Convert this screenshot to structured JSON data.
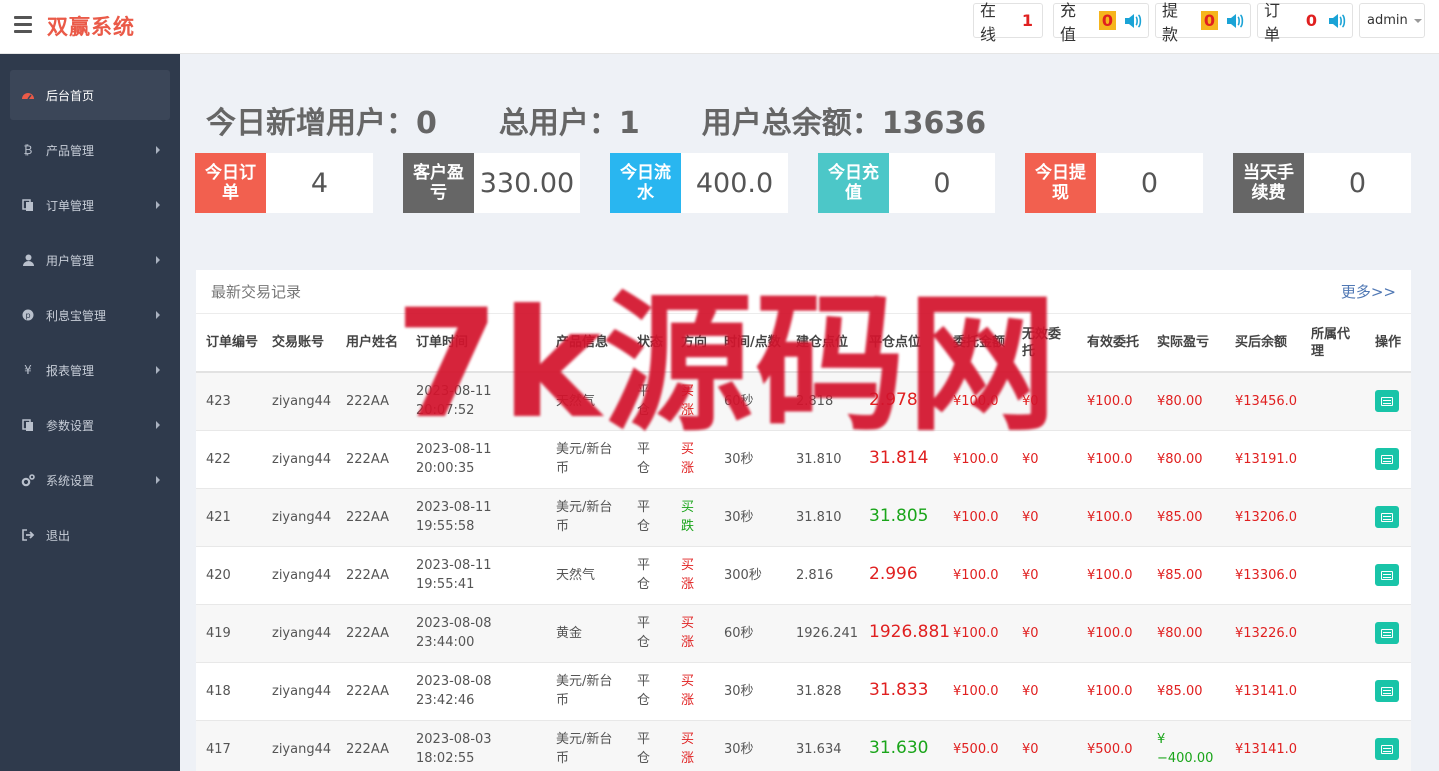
{
  "app": {
    "brand": "双赢系统"
  },
  "topbar": {
    "online_label": "在线",
    "online_count": "1",
    "recharge_label": "充值",
    "recharge_count": "0",
    "withdraw_label": "提款",
    "withdraw_count": "0",
    "order_label": "订单",
    "order_count": "0",
    "admin": "admin"
  },
  "sidebar": {
    "items": [
      {
        "label": "后台首页",
        "icon": "dashboard-icon"
      },
      {
        "label": "产品管理",
        "icon": "bitcoin-icon"
      },
      {
        "label": "订单管理",
        "icon": "copy-icon"
      },
      {
        "label": "用户管理",
        "icon": "user-icon"
      },
      {
        "label": "利息宝管理",
        "icon": "pinterest-icon"
      },
      {
        "label": "报表管理",
        "icon": "yen-icon"
      },
      {
        "label": "参数设置",
        "icon": "copy-icon"
      },
      {
        "label": "系统设置",
        "icon": "gears-icon"
      },
      {
        "label": "退出",
        "icon": "sign-out-icon"
      }
    ]
  },
  "summary": {
    "new_users": "今日新增用户：0",
    "total_users": "总用户：1",
    "total_balance": "用户总余额：13636"
  },
  "kpis": [
    {
      "label": "今日订单",
      "value": "4",
      "color": "#f2604f"
    },
    {
      "label": "客户盈亏",
      "value": "330.00",
      "color": "#666666"
    },
    {
      "label": "今日流水",
      "value": "400.0",
      "color": "#29b6f0"
    },
    {
      "label": "今日充值",
      "value": "0",
      "color": "#4cc7c8"
    },
    {
      "label": "今日提现",
      "value": "0",
      "color": "#f2604f"
    },
    {
      "label": "当天手续费",
      "value": "0",
      "color": "#666666"
    }
  ],
  "panel": {
    "title": "最新交易记录",
    "more": "更多>>",
    "headers": [
      "订单编号",
      "交易账号",
      "用户姓名",
      "订单时间",
      "产品信息",
      "状态",
      "方向",
      "时间/点数",
      "建仓点位",
      "平仓点位",
      "委托金额",
      "无效委托",
      "有效委托",
      "实际盈亏",
      "买后余额",
      "所属代理",
      "操作"
    ],
    "rows": [
      {
        "id": "423",
        "account": "ziyang44",
        "name": "222AA",
        "time": "2023-08-11 20:07:52",
        "product": "天然气",
        "status": "平仓",
        "direction": "买涨",
        "dir_color": "red",
        "period": "60秒",
        "open": "2.818",
        "close": "2.978",
        "close_color": "red",
        "entrust": "¥100.0",
        "invalid": "¥0",
        "valid": "¥100.0",
        "pnl": "¥80.00",
        "pnl_color": "red",
        "balance": "¥13456.0",
        "agent": ""
      },
      {
        "id": "422",
        "account": "ziyang44",
        "name": "222AA",
        "time": "2023-08-11 20:00:35",
        "product": "美元/新台币",
        "status": "平仓",
        "direction": "买涨",
        "dir_color": "red",
        "period": "30秒",
        "open": "31.810",
        "close": "31.814",
        "close_color": "red",
        "entrust": "¥100.0",
        "invalid": "¥0",
        "valid": "¥100.0",
        "pnl": "¥80.00",
        "pnl_color": "red",
        "balance": "¥13191.0",
        "agent": ""
      },
      {
        "id": "421",
        "account": "ziyang44",
        "name": "222AA",
        "time": "2023-08-11 19:55:58",
        "product": "美元/新台币",
        "status": "平仓",
        "direction": "买跌",
        "dir_color": "green",
        "period": "30秒",
        "open": "31.810",
        "close": "31.805",
        "close_color": "green",
        "entrust": "¥100.0",
        "invalid": "¥0",
        "valid": "¥100.0",
        "pnl": "¥85.00",
        "pnl_color": "red",
        "balance": "¥13206.0",
        "agent": ""
      },
      {
        "id": "420",
        "account": "ziyang44",
        "name": "222AA",
        "time": "2023-08-11 19:55:41",
        "product": "天然气",
        "status": "平仓",
        "direction": "买涨",
        "dir_color": "red",
        "period": "300秒",
        "open": "2.816",
        "close": "2.996",
        "close_color": "red",
        "entrust": "¥100.0",
        "invalid": "¥0",
        "valid": "¥100.0",
        "pnl": "¥85.00",
        "pnl_color": "red",
        "balance": "¥13306.0",
        "agent": ""
      },
      {
        "id": "419",
        "account": "ziyang44",
        "name": "222AA",
        "time": "2023-08-08 23:44:00",
        "product": "黄金",
        "status": "平仓",
        "direction": "买涨",
        "dir_color": "red",
        "period": "60秒",
        "open": "1926.241",
        "close": "1926.881",
        "close_color": "red",
        "entrust": "¥100.0",
        "invalid": "¥0",
        "valid": "¥100.0",
        "pnl": "¥80.00",
        "pnl_color": "red",
        "balance": "¥13226.0",
        "agent": ""
      },
      {
        "id": "418",
        "account": "ziyang44",
        "name": "222AA",
        "time": "2023-08-08 23:42:46",
        "product": "美元/新台币",
        "status": "平仓",
        "direction": "买涨",
        "dir_color": "red",
        "period": "30秒",
        "open": "31.828",
        "close": "31.833",
        "close_color": "red",
        "entrust": "¥100.0",
        "invalid": "¥0",
        "valid": "¥100.0",
        "pnl": "¥85.00",
        "pnl_color": "red",
        "balance": "¥13141.0",
        "agent": ""
      },
      {
        "id": "417",
        "account": "ziyang44",
        "name": "222AA",
        "time": "2023-08-03 18:02:55",
        "product": "美元/新台币",
        "status": "平仓",
        "direction": "买涨",
        "dir_color": "red",
        "period": "30秒",
        "open": "31.634",
        "close": "31.630",
        "close_color": "green",
        "entrust": "¥500.0",
        "invalid": "¥0",
        "valid": "¥500.0",
        "pnl": "¥−400.00",
        "pnl_color": "green",
        "balance": "¥13141.0",
        "agent": ""
      }
    ]
  },
  "watermark": "7k源码网"
}
